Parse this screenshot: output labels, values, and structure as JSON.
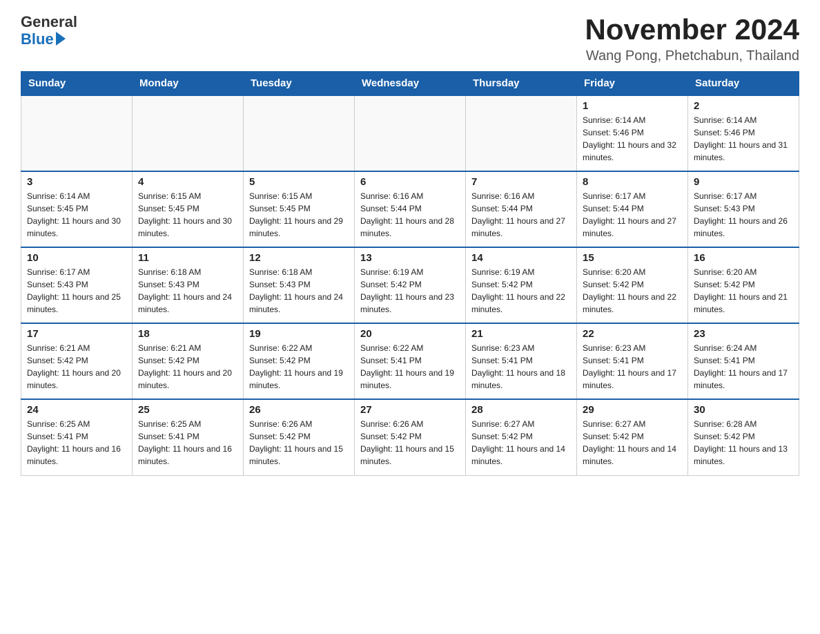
{
  "header": {
    "logo_general": "General",
    "logo_blue": "Blue",
    "month_title": "November 2024",
    "location": "Wang Pong, Phetchabun, Thailand"
  },
  "days_of_week": [
    "Sunday",
    "Monday",
    "Tuesday",
    "Wednesday",
    "Thursday",
    "Friday",
    "Saturday"
  ],
  "weeks": [
    [
      {
        "day": "",
        "info": ""
      },
      {
        "day": "",
        "info": ""
      },
      {
        "day": "",
        "info": ""
      },
      {
        "day": "",
        "info": ""
      },
      {
        "day": "",
        "info": ""
      },
      {
        "day": "1",
        "info": "Sunrise: 6:14 AM\nSunset: 5:46 PM\nDaylight: 11 hours and 32 minutes."
      },
      {
        "day": "2",
        "info": "Sunrise: 6:14 AM\nSunset: 5:46 PM\nDaylight: 11 hours and 31 minutes."
      }
    ],
    [
      {
        "day": "3",
        "info": "Sunrise: 6:14 AM\nSunset: 5:45 PM\nDaylight: 11 hours and 30 minutes."
      },
      {
        "day": "4",
        "info": "Sunrise: 6:15 AM\nSunset: 5:45 PM\nDaylight: 11 hours and 30 minutes."
      },
      {
        "day": "5",
        "info": "Sunrise: 6:15 AM\nSunset: 5:45 PM\nDaylight: 11 hours and 29 minutes."
      },
      {
        "day": "6",
        "info": "Sunrise: 6:16 AM\nSunset: 5:44 PM\nDaylight: 11 hours and 28 minutes."
      },
      {
        "day": "7",
        "info": "Sunrise: 6:16 AM\nSunset: 5:44 PM\nDaylight: 11 hours and 27 minutes."
      },
      {
        "day": "8",
        "info": "Sunrise: 6:17 AM\nSunset: 5:44 PM\nDaylight: 11 hours and 27 minutes."
      },
      {
        "day": "9",
        "info": "Sunrise: 6:17 AM\nSunset: 5:43 PM\nDaylight: 11 hours and 26 minutes."
      }
    ],
    [
      {
        "day": "10",
        "info": "Sunrise: 6:17 AM\nSunset: 5:43 PM\nDaylight: 11 hours and 25 minutes."
      },
      {
        "day": "11",
        "info": "Sunrise: 6:18 AM\nSunset: 5:43 PM\nDaylight: 11 hours and 24 minutes."
      },
      {
        "day": "12",
        "info": "Sunrise: 6:18 AM\nSunset: 5:43 PM\nDaylight: 11 hours and 24 minutes."
      },
      {
        "day": "13",
        "info": "Sunrise: 6:19 AM\nSunset: 5:42 PM\nDaylight: 11 hours and 23 minutes."
      },
      {
        "day": "14",
        "info": "Sunrise: 6:19 AM\nSunset: 5:42 PM\nDaylight: 11 hours and 22 minutes."
      },
      {
        "day": "15",
        "info": "Sunrise: 6:20 AM\nSunset: 5:42 PM\nDaylight: 11 hours and 22 minutes."
      },
      {
        "day": "16",
        "info": "Sunrise: 6:20 AM\nSunset: 5:42 PM\nDaylight: 11 hours and 21 minutes."
      }
    ],
    [
      {
        "day": "17",
        "info": "Sunrise: 6:21 AM\nSunset: 5:42 PM\nDaylight: 11 hours and 20 minutes."
      },
      {
        "day": "18",
        "info": "Sunrise: 6:21 AM\nSunset: 5:42 PM\nDaylight: 11 hours and 20 minutes."
      },
      {
        "day": "19",
        "info": "Sunrise: 6:22 AM\nSunset: 5:42 PM\nDaylight: 11 hours and 19 minutes."
      },
      {
        "day": "20",
        "info": "Sunrise: 6:22 AM\nSunset: 5:41 PM\nDaylight: 11 hours and 19 minutes."
      },
      {
        "day": "21",
        "info": "Sunrise: 6:23 AM\nSunset: 5:41 PM\nDaylight: 11 hours and 18 minutes."
      },
      {
        "day": "22",
        "info": "Sunrise: 6:23 AM\nSunset: 5:41 PM\nDaylight: 11 hours and 17 minutes."
      },
      {
        "day": "23",
        "info": "Sunrise: 6:24 AM\nSunset: 5:41 PM\nDaylight: 11 hours and 17 minutes."
      }
    ],
    [
      {
        "day": "24",
        "info": "Sunrise: 6:25 AM\nSunset: 5:41 PM\nDaylight: 11 hours and 16 minutes."
      },
      {
        "day": "25",
        "info": "Sunrise: 6:25 AM\nSunset: 5:41 PM\nDaylight: 11 hours and 16 minutes."
      },
      {
        "day": "26",
        "info": "Sunrise: 6:26 AM\nSunset: 5:42 PM\nDaylight: 11 hours and 15 minutes."
      },
      {
        "day": "27",
        "info": "Sunrise: 6:26 AM\nSunset: 5:42 PM\nDaylight: 11 hours and 15 minutes."
      },
      {
        "day": "28",
        "info": "Sunrise: 6:27 AM\nSunset: 5:42 PM\nDaylight: 11 hours and 14 minutes."
      },
      {
        "day": "29",
        "info": "Sunrise: 6:27 AM\nSunset: 5:42 PM\nDaylight: 11 hours and 14 minutes."
      },
      {
        "day": "30",
        "info": "Sunrise: 6:28 AM\nSunset: 5:42 PM\nDaylight: 11 hours and 13 minutes."
      }
    ]
  ]
}
